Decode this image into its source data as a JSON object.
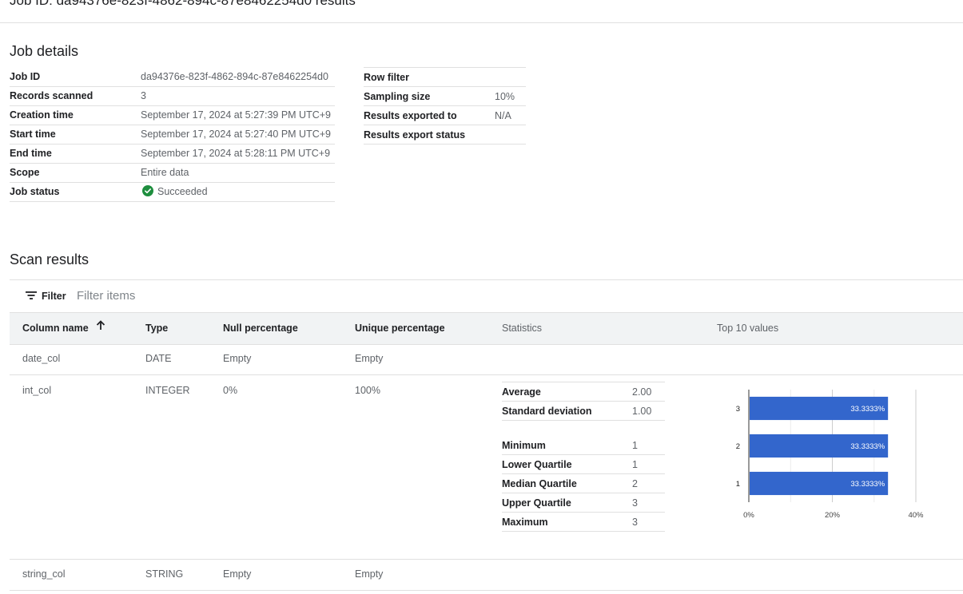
{
  "page": {
    "title": "Job ID: da94376e-823f-4862-894c-87e8462254d0 results"
  },
  "job_details": {
    "section_title": "Job details",
    "left": [
      {
        "label": "Job ID",
        "value": "da94376e-823f-4862-894c-87e8462254d0"
      },
      {
        "label": "Records scanned",
        "value": "3"
      },
      {
        "label": "Creation time",
        "value": "September 17, 2024 at 5:27:39 PM UTC+9"
      },
      {
        "label": "Start time",
        "value": "September 17, 2024 at 5:27:40 PM UTC+9"
      },
      {
        "label": "End time",
        "value": "September 17, 2024 at 5:28:11 PM UTC+9"
      },
      {
        "label": "Scope",
        "value": "Entire data"
      },
      {
        "label": "Job status",
        "value": "Succeeded",
        "icon": "check-circle-icon",
        "icon_color": "#1e8e3e"
      }
    ],
    "right": [
      {
        "label": "Row filter",
        "value": ""
      },
      {
        "label": "Sampling size",
        "value": "10%"
      },
      {
        "label": "Results exported to",
        "value": "N/A"
      },
      {
        "label": "Results export status",
        "value": ""
      }
    ]
  },
  "scan_results": {
    "section_title": "Scan results",
    "filter": {
      "label": "Filter",
      "placeholder": "Filter items",
      "value": "",
      "icon": "filter-list-icon"
    },
    "columns": {
      "column_name": "Column name",
      "type": "Type",
      "null_percentage": "Null percentage",
      "unique_percentage": "Unique percentage",
      "statistics": "Statistics",
      "top_values": "Top 10 values",
      "sort_icon": "arrow-upward-icon"
    },
    "rows": [
      {
        "name": "date_col",
        "type": "DATE",
        "null_pct": "Empty",
        "unique_pct": "Empty"
      },
      {
        "name": "int_col",
        "type": "INTEGER",
        "null_pct": "0%",
        "unique_pct": "100%",
        "stats_summary": [
          {
            "label": "Average",
            "value": "2.00"
          },
          {
            "label": "Standard deviation",
            "value": "1.00"
          }
        ],
        "stats_quartiles": [
          {
            "label": "Minimum",
            "value": "1"
          },
          {
            "label": "Lower Quartile",
            "value": "1"
          },
          {
            "label": "Median Quartile",
            "value": "2"
          },
          {
            "label": "Upper Quartile",
            "value": "3"
          },
          {
            "label": "Maximum",
            "value": "3"
          }
        ]
      },
      {
        "name": "string_col",
        "type": "STRING",
        "null_pct": "Empty",
        "unique_pct": "Empty"
      }
    ]
  },
  "chart_data": {
    "type": "bar",
    "orientation": "horizontal",
    "categories": [
      "3",
      "2",
      "1"
    ],
    "values": [
      33.3333,
      33.3333,
      33.3333
    ],
    "data_labels": [
      "33.3333%",
      "33.3333%",
      "33.3333%"
    ],
    "xlim": [
      0,
      40
    ],
    "x_ticks": [
      "0%",
      "20%",
      "40%"
    ],
    "grid": true,
    "bar_color": "#3366cc",
    "title": "",
    "xlabel": "",
    "ylabel": ""
  }
}
